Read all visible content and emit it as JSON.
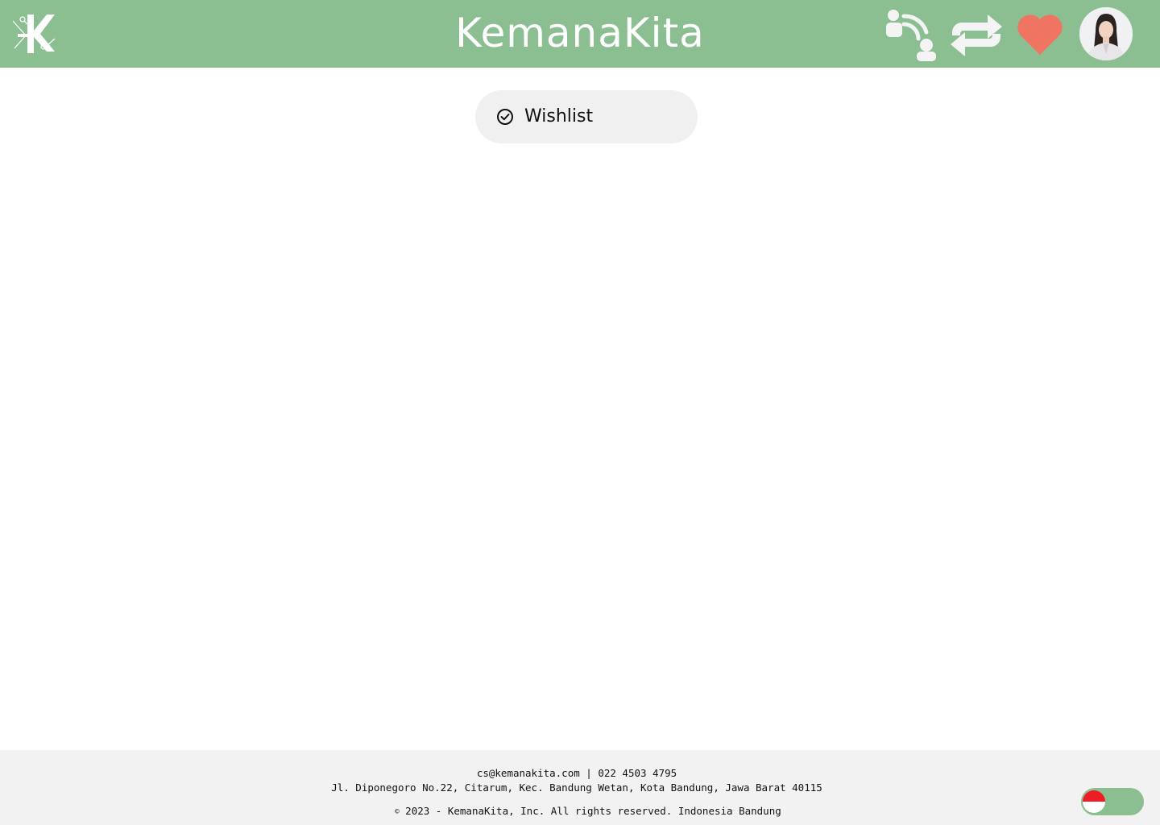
{
  "header": {
    "brand": "KemanaKita",
    "background_color": "#8bbf91",
    "logo_icon": "kk-logo-icon",
    "nav_icons": [
      "consultation-icon",
      "swap-arrows-icon",
      "heart-icon"
    ],
    "heart_color": "#f07462",
    "avatar": "user-avatar"
  },
  "main": {
    "wishlist_pill": {
      "icon": "check-circle-icon",
      "label": "Wishlist"
    }
  },
  "footer": {
    "contact": "cs@kemanakita.com | 022 4503 4795",
    "address": "Jl. Diponegoro No.22, Citarum, Kec. Bandung Wetan, Kota Bandung, Jawa Barat 40115",
    "copyright_symbol": "©",
    "copyright": "2023 - KemanaKita, Inc. All rights reserved. Indonesia Bandung",
    "language_toggle": {
      "flag": "indonesia-flag-icon",
      "toggle_color": "#8bbf91"
    }
  }
}
